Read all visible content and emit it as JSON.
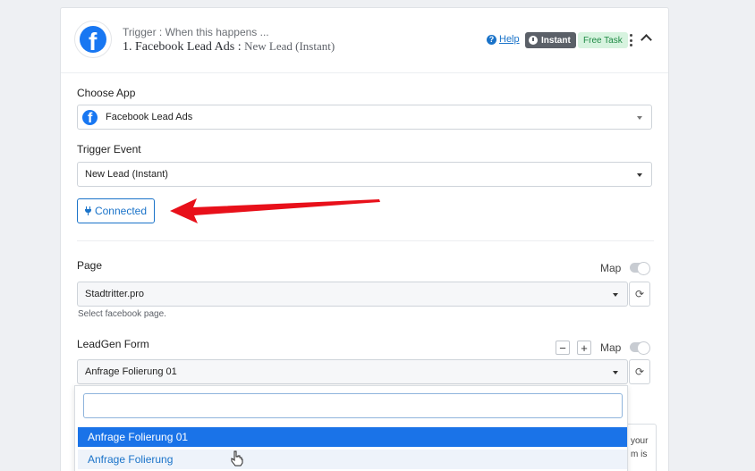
{
  "header": {
    "subtitle": "Trigger : When this happens ...",
    "title_prefix": "1. Facebook Lead Ads : ",
    "title_event": "New Lead (Instant)",
    "help_label": "Help",
    "instant_label": "Instant",
    "free_task_label": "Free Task"
  },
  "choose_app": {
    "label": "Choose App",
    "value": "Facebook Lead Ads"
  },
  "trigger_event": {
    "label": "Trigger Event",
    "value": "New Lead (Instant)"
  },
  "connected_button": {
    "label": "Connected"
  },
  "page_field": {
    "label": "Page",
    "map_label": "Map",
    "value": "Stadtritter.pro",
    "hint": "Select facebook page."
  },
  "leadgen_field": {
    "label": "LeadGen Form",
    "map_label": "Map",
    "minus_label": "−",
    "plus_label": "+",
    "value": "Anfrage Folierung 01"
  },
  "dropdown": {
    "search_value": "",
    "options": [
      {
        "label": "Anfrage Folierung 01",
        "state": "active"
      },
      {
        "label": "Anfrage Folierung",
        "state": "hover"
      }
    ]
  },
  "side_note": {
    "line1": "your",
    "line2": "m is"
  },
  "colors": {
    "accent": "#1a73c9",
    "facebook": "#1877f2",
    "annotation_arrow": "#e8101a",
    "free_task_bg": "#d7f3df"
  },
  "icons": [
    "facebook-logo-icon",
    "help-icon",
    "clock-icon",
    "kebab-menu-icon",
    "chevron-up-icon",
    "caret-down-icon",
    "plug-icon",
    "refresh-icon",
    "hand-cursor-icon",
    "red-arrow-annotation"
  ]
}
